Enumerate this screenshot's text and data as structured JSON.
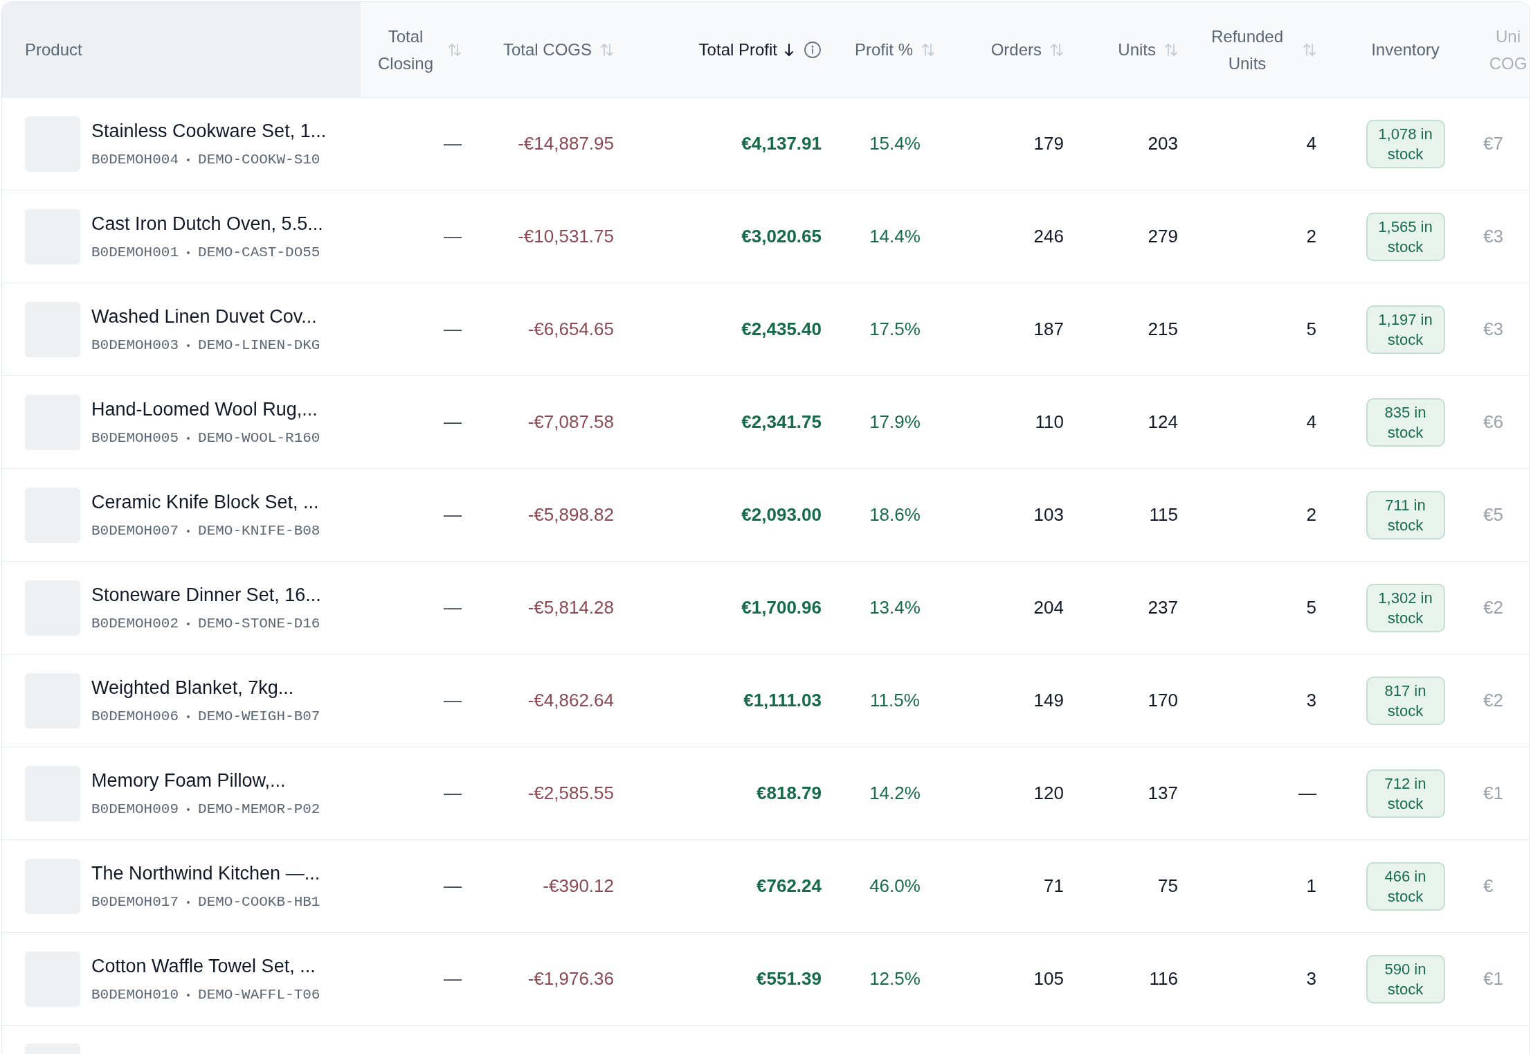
{
  "table": {
    "columns": [
      {
        "label": "Product",
        "sortable": false,
        "sorted": false
      },
      {
        "label": "Total Closing",
        "sortable": true,
        "sorted": false
      },
      {
        "label": "Total COGS",
        "sortable": true,
        "sorted": false
      },
      {
        "label": "Total Profit",
        "sortable": true,
        "sorted": true,
        "info": true
      },
      {
        "label": "Profit %",
        "sortable": true,
        "sorted": false
      },
      {
        "label": "Orders",
        "sortable": true,
        "sorted": false
      },
      {
        "label": "Units",
        "sortable": true,
        "sorted": false
      },
      {
        "label": "Refunded Units",
        "sortable": true,
        "sorted": false
      },
      {
        "label": "Inventory",
        "sortable": false,
        "sorted": false
      },
      {
        "label": "Uni COG",
        "sortable": false,
        "sorted": false
      }
    ],
    "rows": [
      {
        "name": "Stainless Cookware Set, 1...",
        "asin": "B0DEMOH004",
        "sku": "DEMO-COOKW-S10",
        "closing": "—",
        "cogs": "-€14,887.95",
        "profit": "€4,137.91",
        "profit_pct": "15.4%",
        "orders": "179",
        "units": "203",
        "refunded": "4",
        "inventory": "1,078 in stock",
        "column_10": "€7"
      },
      {
        "name": "Cast Iron Dutch Oven, 5.5...",
        "asin": "B0DEMOH001",
        "sku": "DEMO-CAST-DO55",
        "closing": "—",
        "cogs": "-€10,531.75",
        "profit": "€3,020.65",
        "profit_pct": "14.4%",
        "orders": "246",
        "units": "279",
        "refunded": "2",
        "inventory": "1,565 in stock",
        "column_10": "€3"
      },
      {
        "name": "Washed Linen Duvet Cov...",
        "asin": "B0DEMOH003",
        "sku": "DEMO-LINEN-DKG",
        "closing": "—",
        "cogs": "-€6,654.65",
        "profit": "€2,435.40",
        "profit_pct": "17.5%",
        "orders": "187",
        "units": "215",
        "refunded": "5",
        "inventory": "1,197 in stock",
        "column_10": "€3"
      },
      {
        "name": "Hand-Loomed Wool Rug,...",
        "asin": "B0DEMOH005",
        "sku": "DEMO-WOOL-R160",
        "closing": "—",
        "cogs": "-€7,087.58",
        "profit": "€2,341.75",
        "profit_pct": "17.9%",
        "orders": "110",
        "units": "124",
        "refunded": "4",
        "inventory": "835 in stock",
        "column_10": "€6"
      },
      {
        "name": "Ceramic Knife Block Set, ...",
        "asin": "B0DEMOH007",
        "sku": "DEMO-KNIFE-B08",
        "closing": "—",
        "cogs": "-€5,898.82",
        "profit": "€2,093.00",
        "profit_pct": "18.6%",
        "orders": "103",
        "units": "115",
        "refunded": "2",
        "inventory": "711 in stock",
        "column_10": "€5"
      },
      {
        "name": "Stoneware Dinner Set, 16...",
        "asin": "B0DEMOH002",
        "sku": "DEMO-STONE-D16",
        "closing": "—",
        "cogs": "-€5,814.28",
        "profit": "€1,700.96",
        "profit_pct": "13.4%",
        "orders": "204",
        "units": "237",
        "refunded": "5",
        "inventory": "1,302 in stock",
        "column_10": "€2"
      },
      {
        "name": "Weighted Blanket, 7kg...",
        "asin": "B0DEMOH006",
        "sku": "DEMO-WEIGH-B07",
        "closing": "—",
        "cogs": "-€4,862.64",
        "profit": "€1,111.03",
        "profit_pct": "11.5%",
        "orders": "149",
        "units": "170",
        "refunded": "3",
        "inventory": "817 in stock",
        "column_10": "€2"
      },
      {
        "name": "Memory Foam Pillow,...",
        "asin": "B0DEMOH009",
        "sku": "DEMO-MEMOR-P02",
        "closing": "—",
        "cogs": "-€2,585.55",
        "profit": "€818.79",
        "profit_pct": "14.2%",
        "orders": "120",
        "units": "137",
        "refunded": "—",
        "inventory": "712 in stock",
        "column_10": "€1"
      },
      {
        "name": "The Northwind Kitchen —...",
        "asin": "B0DEMOH017",
        "sku": "DEMO-COOKB-HB1",
        "closing": "—",
        "cogs": "-€390.12",
        "profit": "€762.24",
        "profit_pct": "46.0%",
        "orders": "71",
        "units": "75",
        "refunded": "1",
        "inventory": "466 in stock",
        "column_10": "€"
      },
      {
        "name": "Cotton Waffle Towel Set, ...",
        "asin": "B0DEMOH010",
        "sku": "DEMO-WAFFL-T06",
        "closing": "—",
        "cogs": "-€1,976.36",
        "profit": "€551.39",
        "profit_pct": "12.5%",
        "orders": "105",
        "units": "116",
        "refunded": "3",
        "inventory": "590 in stock",
        "column_10": "€1"
      }
    ]
  }
}
